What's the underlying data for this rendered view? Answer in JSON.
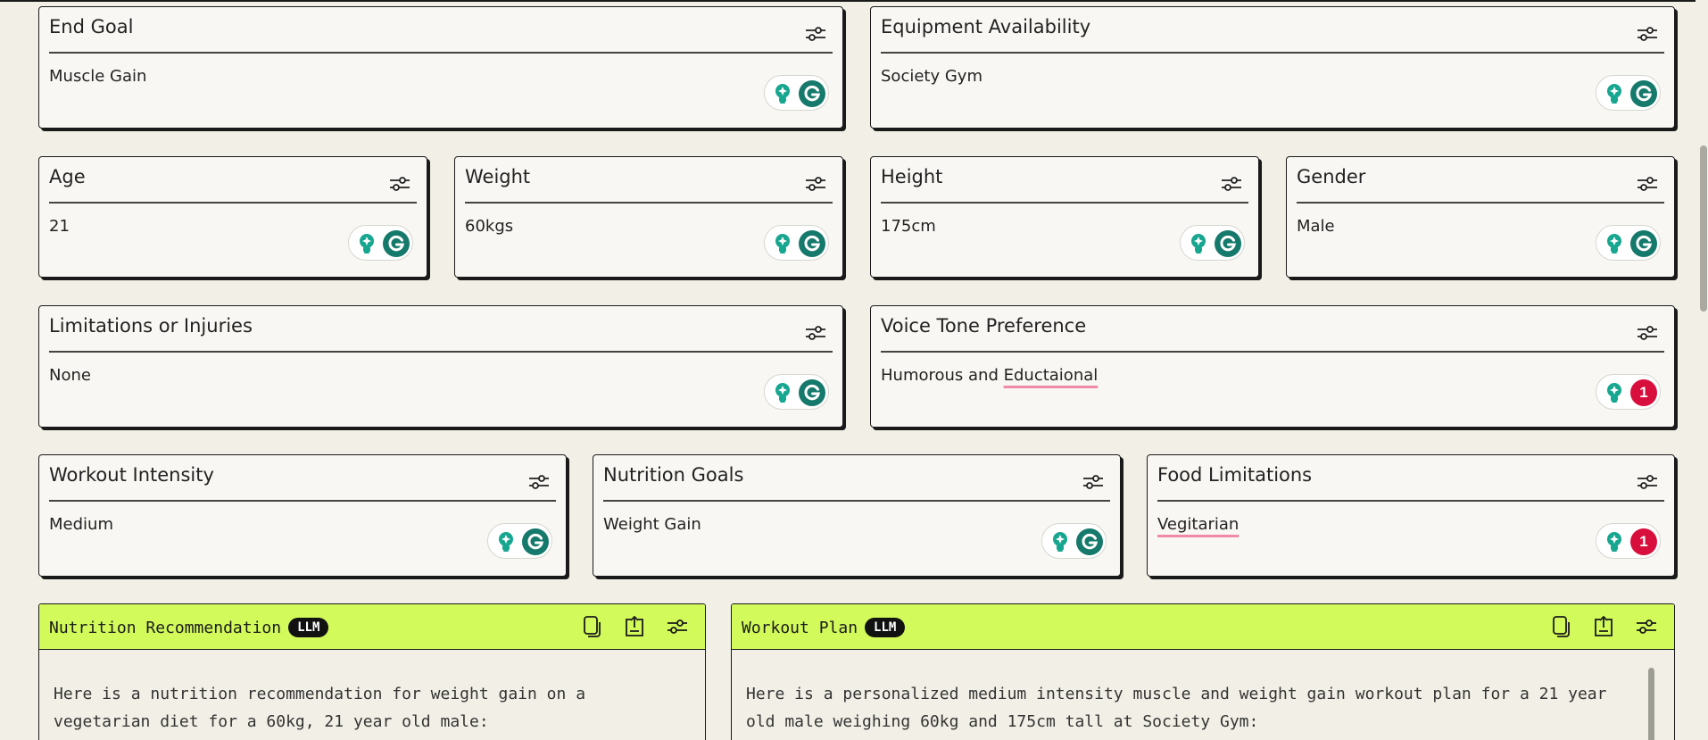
{
  "fields": {
    "end_goal": {
      "title": "End Goal",
      "value": "Muscle Gain"
    },
    "equipment": {
      "title": "Equipment Availability",
      "value": "Society Gym"
    },
    "age": {
      "title": "Age",
      "value": "21"
    },
    "weight": {
      "title": "Weight",
      "value": "60kgs"
    },
    "height": {
      "title": "Height",
      "value": "175cm"
    },
    "gender": {
      "title": "Gender",
      "value": "Male"
    },
    "limitations": {
      "title": "Limitations or Injuries",
      "value": "None"
    },
    "voice_tone": {
      "title": "Voice Tone Preference",
      "value_prefix": "Humorous and ",
      "value_flagged": "Eductaional",
      "error_count": "1"
    },
    "intensity": {
      "title": "Workout Intensity",
      "value": "Medium"
    },
    "nutrition_goals": {
      "title": "Nutrition Goals",
      "value": "Weight Gain"
    },
    "food_limitations": {
      "title": "Food Limitations",
      "value": "Vegitarian",
      "error_count": "1"
    }
  },
  "panels": {
    "nutrition": {
      "title": "Nutrition Recommendation",
      "badge": "LLM",
      "body": "Here is a nutrition recommendation for weight gain on a\nvegetarian diet for a 60kg, 21 year old male:"
    },
    "workout": {
      "title": "Workout Plan",
      "badge": "LLM",
      "body": "Here is a personalized medium intensity muscle and weight gain workout plan for a 21 year\nold male weighing 60kg and 175cm tall at Society Gym:"
    }
  },
  "icons": {
    "settings": "sliders-icon",
    "assistant": "grammarly-bulb-icon",
    "grammar": "grammarly-g-icon",
    "copy": "copy-icon",
    "export": "export-icon"
  },
  "colors": {
    "accent_lime": "#d2fa5a",
    "grammarly_green": "#15796b",
    "error_red": "#d80f3d",
    "spell_underline": "#f08aa8",
    "background": "#f2f0e6"
  }
}
